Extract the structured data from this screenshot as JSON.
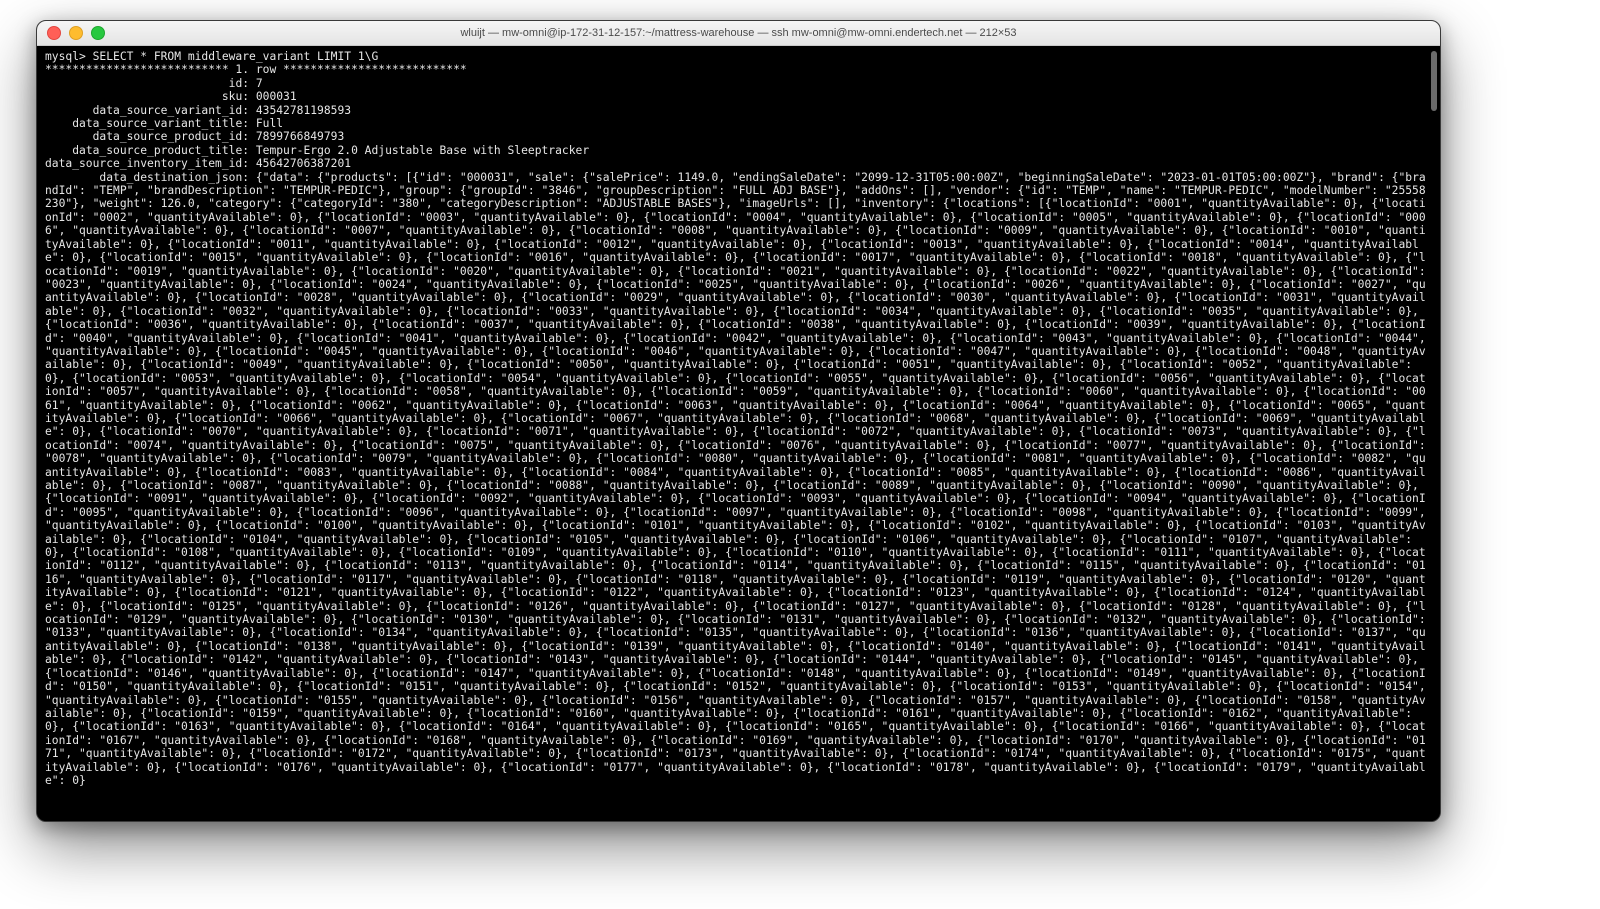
{
  "window": {
    "title": "wluijt — mw-omni@ip-172-31-12-157:~/mattress-warehouse — ssh mw-omni@mw-omni.endertech.net — 212×53",
    "buttons": {
      "close": "close",
      "minimize": "minimize",
      "maximize": "maximize"
    }
  },
  "prompt": "mysql> ",
  "query": "SELECT * FROM middleware_variant LIMIT 1\\G",
  "row_separator": "*************************** 1. row ***************************",
  "fields": [
    {
      "label": "id",
      "value": "7"
    },
    {
      "label": "sku",
      "value": "000031"
    },
    {
      "label": "data_source_variant_id",
      "value": "43542781198593"
    },
    {
      "label": "data_source_variant_title",
      "value": "Full"
    },
    {
      "label": "data_source_product_id",
      "value": "7899766849793"
    },
    {
      "label": "data_source_product_title",
      "value": "Tempur-Ergo 2.0 Adjustable Base with Sleeptracker"
    },
    {
      "label": "data_source_inventory_item_id",
      "value": "45642706387201"
    }
  ],
  "json_field_label": "data_destination_json",
  "json_product": {
    "id": "000031",
    "sale": {
      "salePrice": 1149.0,
      "endingSaleDate": "2099-12-31T05:00:00Z",
      "beginningSaleDate": "2023-01-01T05:00:00Z"
    },
    "brand": {
      "brandId": "TEMP",
      "brandDescription": "TEMPUR-PEDIC"
    },
    "group": {
      "groupId": "3846",
      "groupDescription": "FULL ADJ BASE"
    },
    "addOns": [],
    "vendor": {
      "id": "TEMP",
      "name": "TEMPUR-PEDIC",
      "modelNumber": "25558230"
    },
    "weight": 126.0,
    "category": {
      "categoryId": "380",
      "categoryDescription": "ADJUSTABLE BASES"
    },
    "imageUrls": [],
    "inventory": {
      "location_start": "0001",
      "location_end": "0179",
      "quantityAvailable_all": 0
    }
  }
}
